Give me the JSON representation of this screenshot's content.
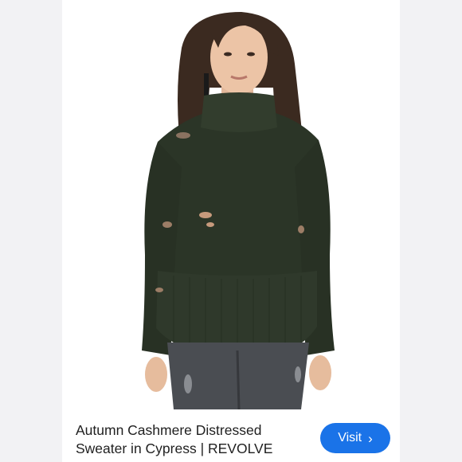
{
  "result": {
    "title_line1": "Autumn Cashmere Distressed",
    "title_line2": "Sweater in Cypress | REVOLVE",
    "visit_label": "Visit",
    "visit_icon": "chevron-right-icon"
  },
  "colors": {
    "accent": "#1a73e8",
    "sweater": "#2b3527",
    "background": "#f2f2f4"
  }
}
